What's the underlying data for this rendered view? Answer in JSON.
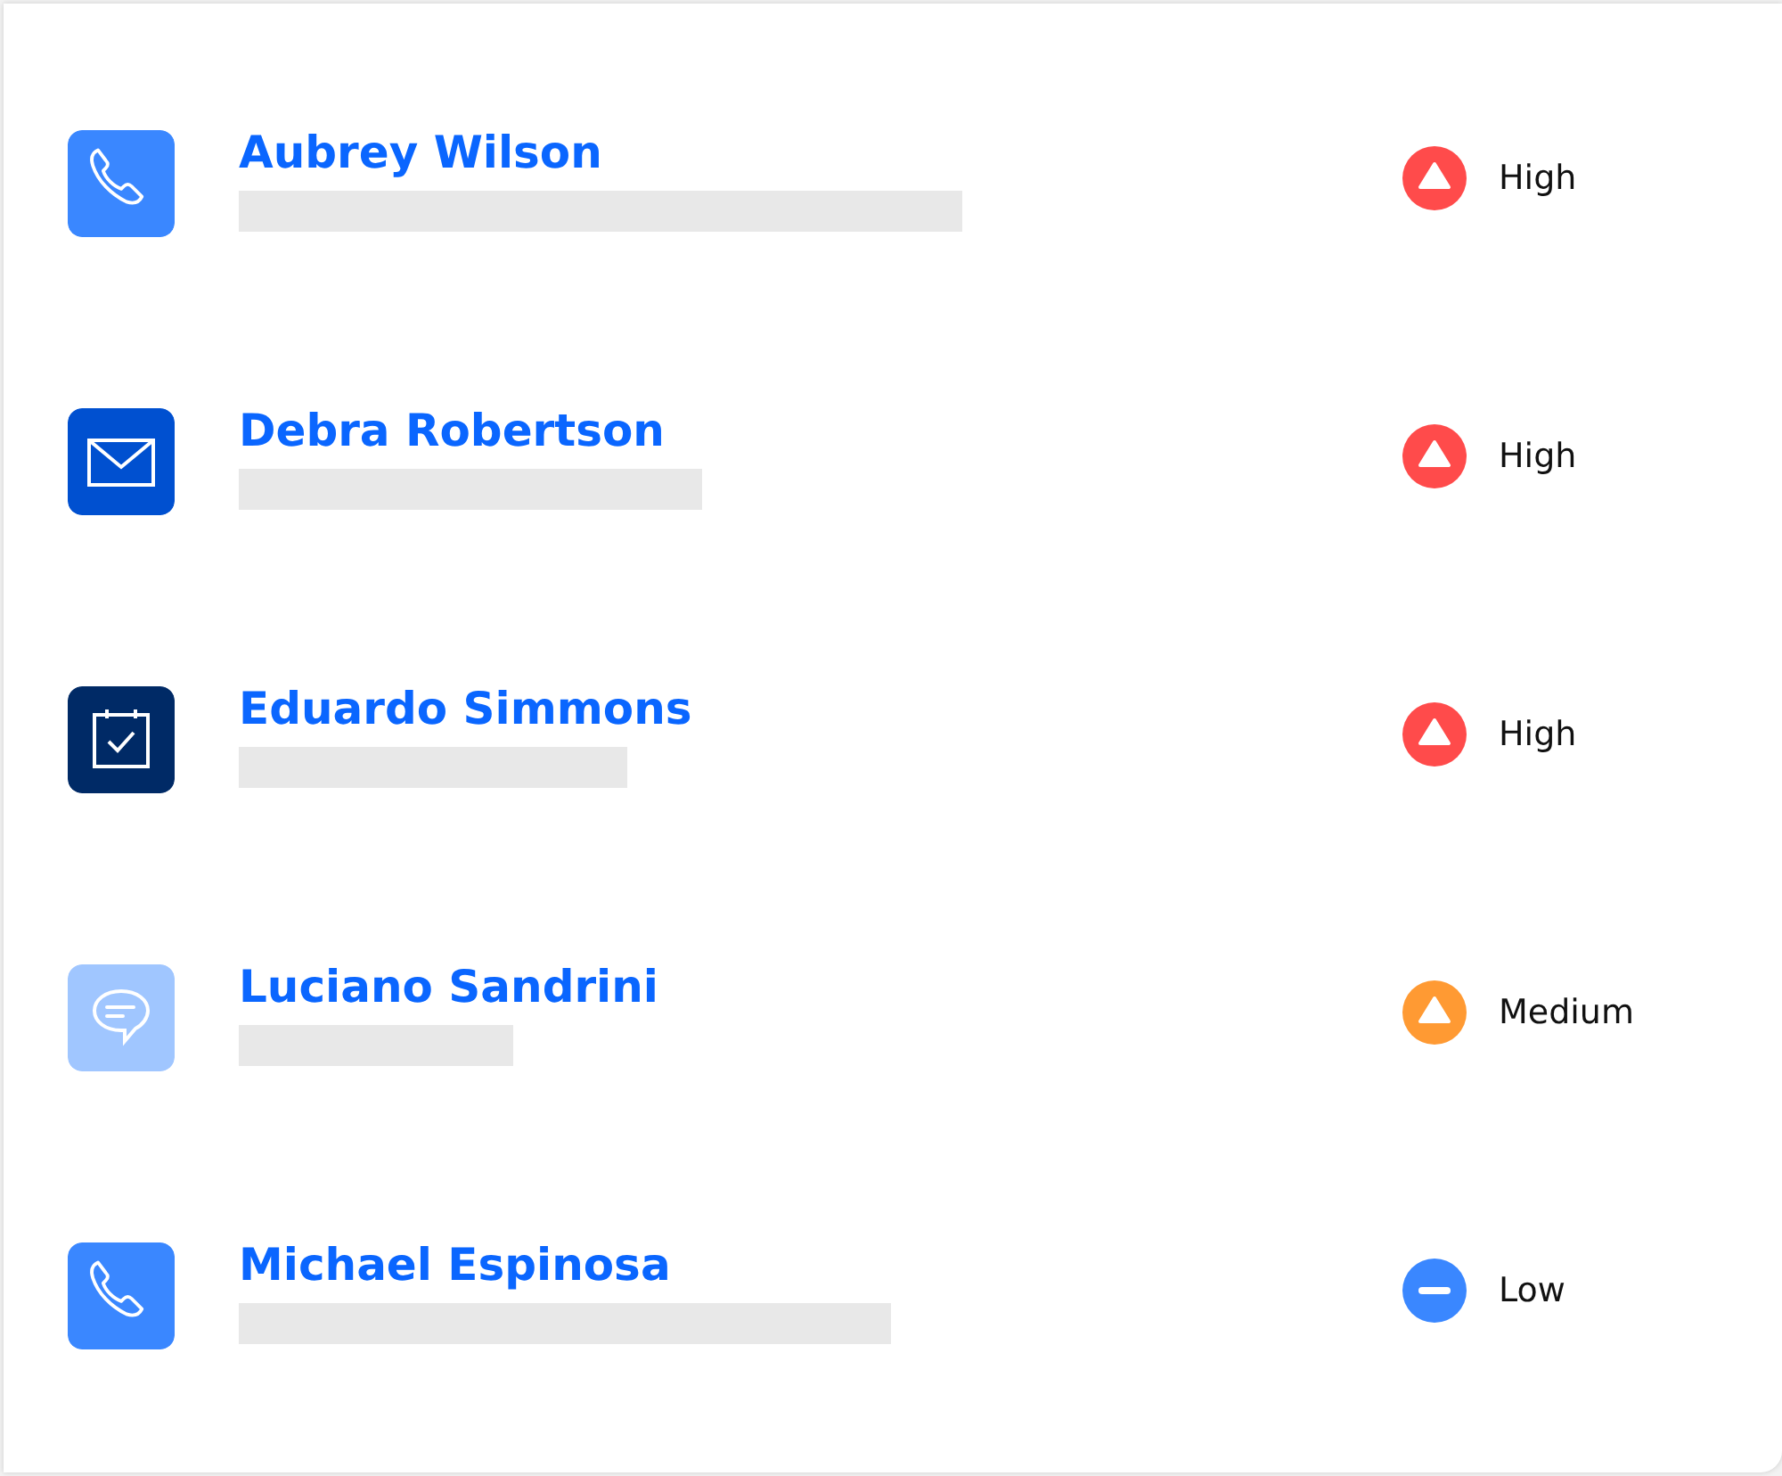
{
  "contacts": [
    {
      "name": "Aubrey Wilson",
      "kind": "phone",
      "priority": {
        "kind": "high",
        "label": "High"
      }
    },
    {
      "name": "Debra Robertson",
      "kind": "email",
      "priority": {
        "kind": "high",
        "label": "High"
      }
    },
    {
      "name": "Eduardo Simmons",
      "kind": "task",
      "priority": {
        "kind": "high",
        "label": "High"
      }
    },
    {
      "name": "Luciano Sandrini",
      "kind": "chat",
      "priority": {
        "kind": "medium",
        "label": "Medium"
      }
    },
    {
      "name": "Michael Espinosa",
      "kind": "phone",
      "priority": {
        "kind": "low",
        "label": "Low"
      }
    }
  ]
}
